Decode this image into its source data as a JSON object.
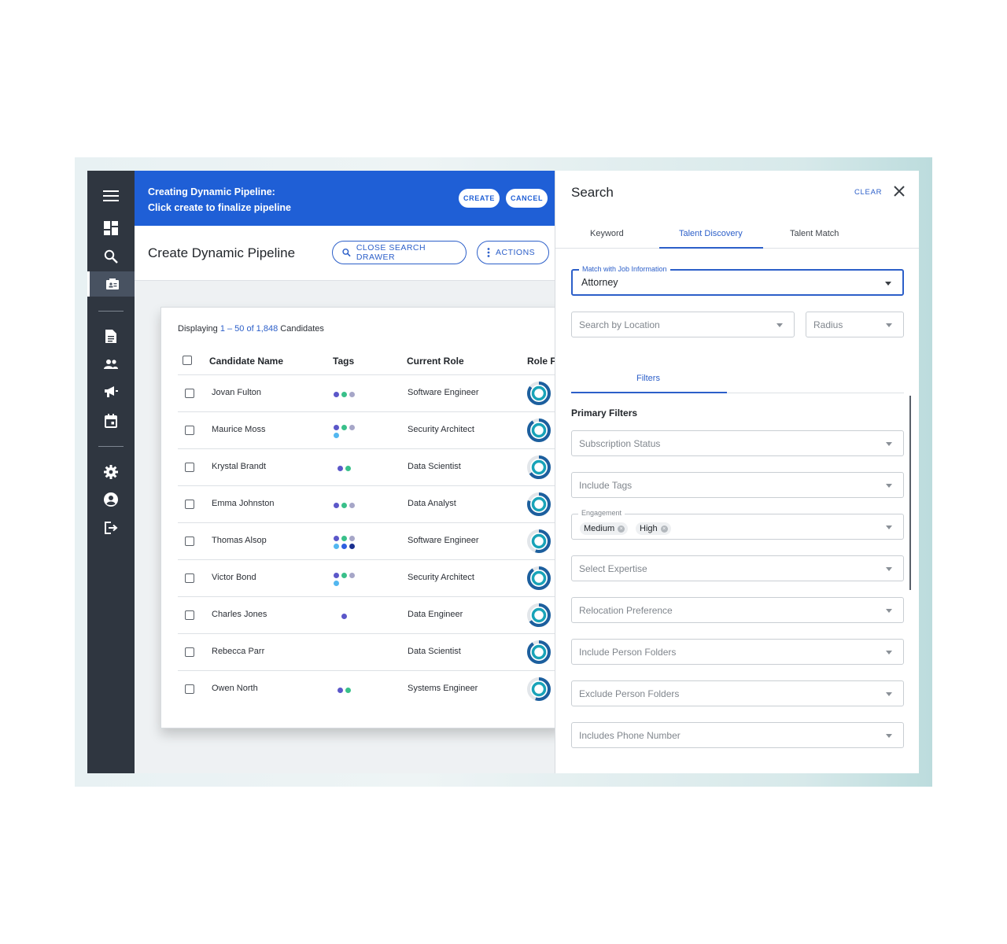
{
  "sidebar": {
    "icons": [
      "menu-icon",
      "dashboard-icon",
      "search-icon",
      "pipeline-icon",
      "document-icon",
      "people-icon",
      "megaphone-icon",
      "calendar-icon",
      "settings-icon",
      "account-icon",
      "logout-icon"
    ]
  },
  "banner": {
    "line1": "Creating Dynamic Pipeline:",
    "line2": "Click create to finalize pipeline",
    "create_label": "CREATE",
    "cancel_label": "CANCEL",
    "color": "#1f5fd6"
  },
  "page": {
    "title": "Create Dynamic Pipeline",
    "close_drawer_label": "CLOSE SEARCH DRAWER",
    "actions_label": "ACTIONS"
  },
  "table": {
    "display_prefix": "Displaying ",
    "display_range": "1 – 50 of 1,848",
    "display_suffix": " Candidates",
    "columns": [
      "Candidate Name",
      "Tags",
      "Current Role",
      "Role F"
    ],
    "rows": [
      {
        "name": "Jovan Fulton",
        "role": "Software Engineer",
        "tags": [
          "#5b57c9",
          "#39c08a",
          "#a6a6c8"
        ],
        "fit": 0.85
      },
      {
        "name": "Maurice Moss",
        "role": "Security Architect",
        "tags": [
          "#5b57c9",
          "#39c08a",
          "#a6a6c8",
          "#52b7f0"
        ],
        "fit": 0.9
      },
      {
        "name": "Krystal Brandt",
        "role": "Data Scientist",
        "tags": [
          "#5b57c9",
          "#39c08a"
        ],
        "fit": 0.65
      },
      {
        "name": "Emma Johnston",
        "role": "Data Analyst",
        "tags": [
          "#5b57c9",
          "#39c08a",
          "#a6a6c8"
        ],
        "fit": 0.8
      },
      {
        "name": "Thomas Alsop",
        "role": "Software Engineer",
        "tags": [
          "#5b57c9",
          "#39c08a",
          "#a6a6c8",
          "#52b7f0",
          "#2f5fe0",
          "#1a2f8f"
        ],
        "fit": 0.55
      },
      {
        "name": "Victor Bond",
        "role": "Security Architect",
        "tags": [
          "#5b57c9",
          "#39c08a",
          "#a6a6c8",
          "#52b7f0"
        ],
        "fit": 0.9
      },
      {
        "name": "Charles Jones",
        "role": "Data Engineer",
        "tags": [
          "#5b57c9"
        ],
        "fit": 0.65
      },
      {
        "name": "Rebecca Parr",
        "role": "Data Scientist",
        "tags": [],
        "fit": 0.9
      },
      {
        "name": "Owen North",
        "role": "Systems Engineer",
        "tags": [
          "#5b57c9",
          "#39c08a"
        ],
        "fit": 0.55
      }
    ]
  },
  "search": {
    "title": "Search",
    "clear_label": "CLEAR",
    "tabs": [
      "Keyword",
      "Talent Discovery",
      "Talent Match"
    ],
    "match_legend": "Match with Job Information",
    "match_value": "Attorney",
    "location_placeholder": "Search by Location",
    "radius_placeholder": "Radius",
    "filters_tab": "Filters",
    "primary_filters_label": "Primary Filters",
    "subscription_status": "Subscription Status",
    "include_tags": "Include Tags",
    "engagement_legend": "Engagement",
    "engagement_chips": [
      "Medium",
      "High"
    ],
    "select_expertise": "Select Expertise",
    "relocation_preference": "Relocation Preference",
    "include_person_folders": "Include Person Folders",
    "exclude_person_folders": "Exclude Person Folders",
    "includes_phone_number": "Includes Phone Number"
  },
  "colors": {
    "accent": "#2c5fc9",
    "sidebar": "#2f3640",
    "ring_dark": "#1c5f9e",
    "ring_teal": "#18a3b8"
  }
}
